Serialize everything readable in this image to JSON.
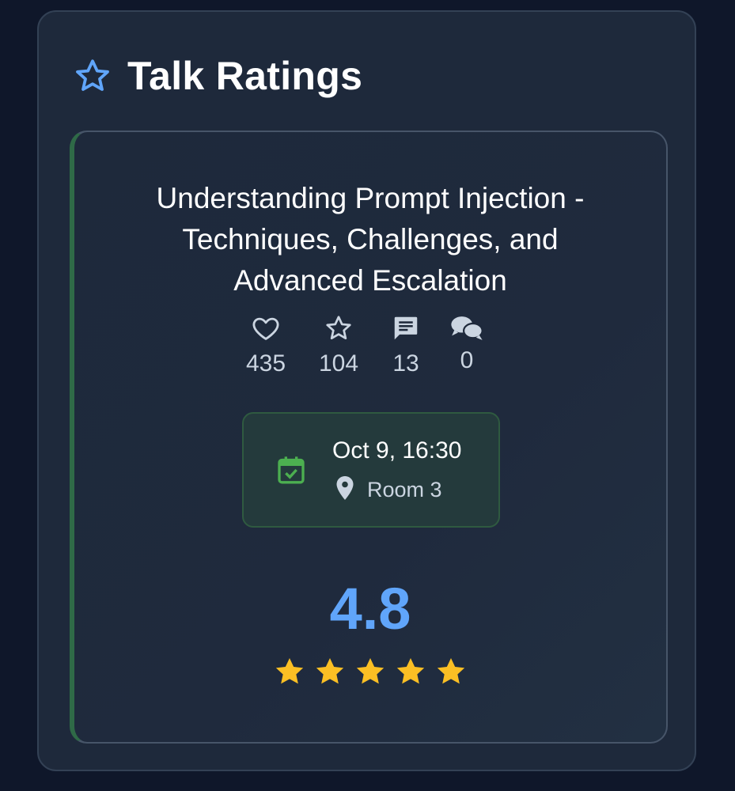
{
  "header": {
    "title": "Talk Ratings",
    "icon": "star-outline-icon",
    "icon_color": "#60a5fa"
  },
  "talk": {
    "title_lines": [
      "Understanding Prompt Injection -",
      "Techniques, Challenges, and",
      "Advanced Escalation"
    ],
    "accent_color": "#2f6a47",
    "stats": {
      "likes": {
        "icon": "heart-icon",
        "value": "435"
      },
      "favorites": {
        "icon": "star-icon",
        "value": "104"
      },
      "comments": {
        "icon": "comment-icon",
        "value": "13"
      },
      "discussions": {
        "icon": "chat-bubbles-icon",
        "value": "0"
      }
    },
    "schedule": {
      "icon": "calendar-check-icon",
      "icon_color": "#4caf50",
      "datetime": "Oct 9, 16:30",
      "location_icon": "location-pin-icon",
      "room": "Room 3"
    },
    "rating": {
      "value": "4.8",
      "value_color": "#60a5fa",
      "stars_filled": 5,
      "stars_total": 5,
      "star_color": "#fbbf24"
    }
  }
}
